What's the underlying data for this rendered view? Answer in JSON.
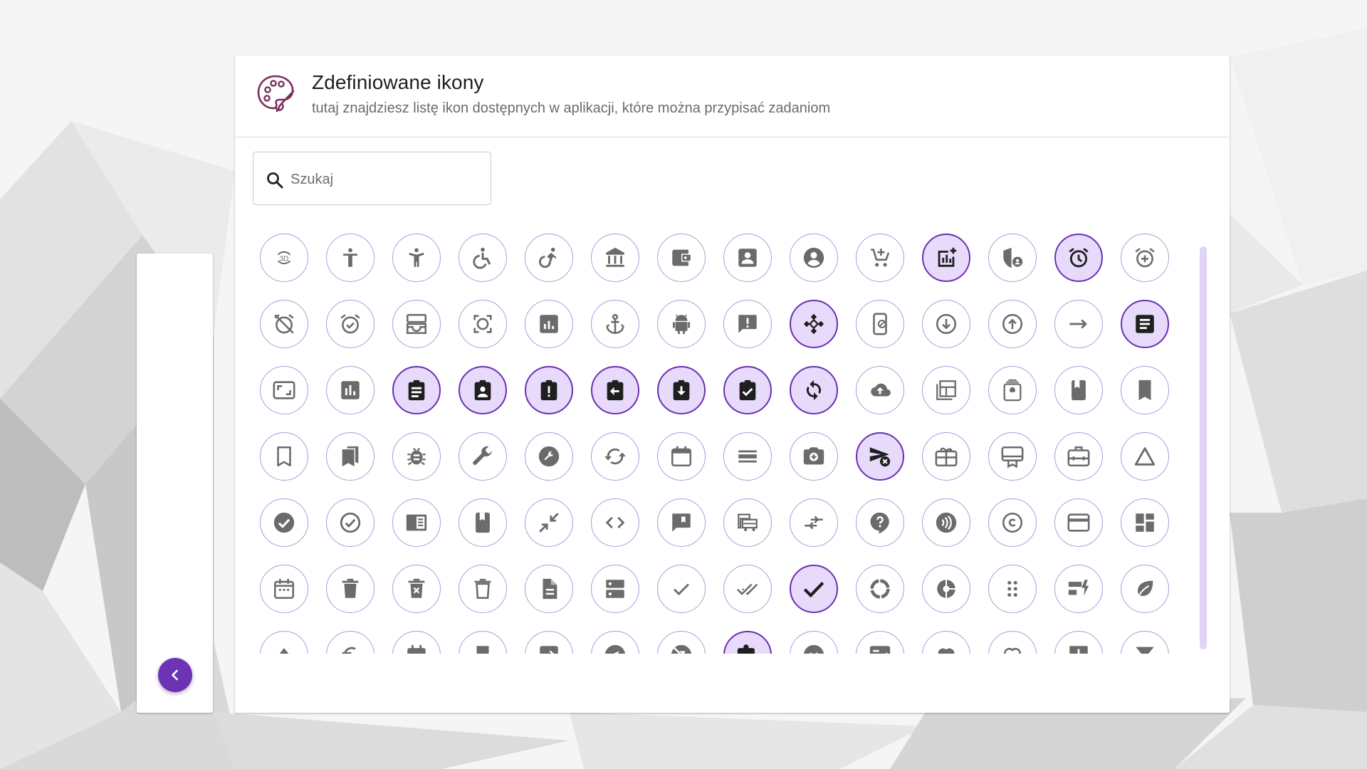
{
  "header": {
    "title": "Zdefiniowane ikony",
    "subtitle": "tutaj znajdziesz listę ikon dostępnych w aplikacji, które można przypisać zadaniom",
    "logo_icon": "palette-icon",
    "icon_color": "#7a2d5c"
  },
  "search": {
    "placeholder": "Szukaj",
    "value": "",
    "icon": "search-icon"
  },
  "sidebar": {
    "collapse_icon": "chevron-left-icon",
    "collapse_color": "#6c34b5"
  },
  "colors": {
    "icon_border": "#b497dd",
    "selected_background": "#e7dafb",
    "selected_border": "#6a2fb3",
    "icon_fill": "#6b6b6b",
    "selected_icon_fill": "#1f1f1f"
  },
  "icons": [
    {
      "name": "3d-rotation-icon",
      "text": "3D",
      "selected": false
    },
    {
      "name": "accessibility-icon",
      "selected": false
    },
    {
      "name": "accessibility-new-icon",
      "selected": false
    },
    {
      "name": "accessible-icon",
      "selected": false
    },
    {
      "name": "accessible-forward-icon",
      "selected": false
    },
    {
      "name": "account-balance-icon",
      "selected": false
    },
    {
      "name": "account-balance-wallet-icon",
      "selected": false
    },
    {
      "name": "account-box-icon",
      "selected": false
    },
    {
      "name": "account-circle-icon",
      "selected": false
    },
    {
      "name": "add-shopping-cart-icon",
      "selected": false
    },
    {
      "name": "addchart-icon",
      "selected": true
    },
    {
      "name": "admin-panel-settings-icon",
      "selected": false
    },
    {
      "name": "alarm-icon",
      "selected": true
    },
    {
      "name": "alarm-add-icon",
      "selected": false
    },
    {
      "name": "alarm-off-icon",
      "selected": false
    },
    {
      "name": "alarm-on-icon",
      "selected": false
    },
    {
      "name": "all-inbox-icon",
      "selected": false
    },
    {
      "name": "all-out-icon",
      "selected": false
    },
    {
      "name": "analytics-icon",
      "selected": false
    },
    {
      "name": "anchor-icon",
      "selected": false
    },
    {
      "name": "android-icon",
      "selected": false
    },
    {
      "name": "announcement-icon",
      "selected": false
    },
    {
      "name": "api-icon",
      "selected": true
    },
    {
      "name": "app-blocking-icon",
      "selected": false
    },
    {
      "name": "arrow-circle-down-icon",
      "selected": false
    },
    {
      "name": "arrow-circle-up-icon",
      "selected": false
    },
    {
      "name": "arrow-right-alt-icon",
      "selected": false
    },
    {
      "name": "article-icon",
      "selected": true
    },
    {
      "name": "aspect-ratio-icon",
      "selected": false
    },
    {
      "name": "assessment-icon",
      "selected": false
    },
    {
      "name": "assignment-icon",
      "selected": true
    },
    {
      "name": "assignment-ind-icon",
      "selected": true
    },
    {
      "name": "assignment-late-icon",
      "selected": true
    },
    {
      "name": "assignment-return-icon",
      "selected": true
    },
    {
      "name": "assignment-returned-icon",
      "selected": true
    },
    {
      "name": "assignment-turned-in-icon",
      "selected": true
    },
    {
      "name": "autorenew-icon",
      "selected": true
    },
    {
      "name": "backup-icon",
      "selected": false
    },
    {
      "name": "backup-table-icon",
      "selected": false
    },
    {
      "name": "batch-prediction-icon",
      "selected": false
    },
    {
      "name": "book-icon",
      "selected": false
    },
    {
      "name": "bookmark-icon",
      "selected": false
    },
    {
      "name": "bookmark-border-icon",
      "selected": false
    },
    {
      "name": "bookmarks-icon",
      "selected": false
    },
    {
      "name": "bug-report-icon",
      "selected": false
    },
    {
      "name": "build-icon",
      "selected": false
    },
    {
      "name": "build-circle-icon",
      "selected": false
    },
    {
      "name": "cached-icon",
      "selected": false
    },
    {
      "name": "calendar-today-icon",
      "selected": false
    },
    {
      "name": "calendar-view-day-icon",
      "selected": false
    },
    {
      "name": "camera-enhance-icon",
      "selected": false
    },
    {
      "name": "cancel-schedule-send-icon",
      "selected": true
    },
    {
      "name": "card-giftcard-icon",
      "selected": false
    },
    {
      "name": "card-membership-icon",
      "selected": false
    },
    {
      "name": "card-travel-icon",
      "selected": false
    },
    {
      "name": "change-history-icon",
      "selected": false
    },
    {
      "name": "check-circle-icon",
      "selected": false
    },
    {
      "name": "check-circle-outline-icon",
      "selected": false
    },
    {
      "name": "chrome-reader-mode-icon",
      "selected": false
    },
    {
      "name": "class-icon",
      "selected": false
    },
    {
      "name": "close-fullscreen-icon",
      "selected": false
    },
    {
      "name": "code-icon",
      "selected": false
    },
    {
      "name": "comment-bank-icon",
      "selected": false
    },
    {
      "name": "commute-icon",
      "selected": false
    },
    {
      "name": "compare-arrows-icon",
      "selected": false
    },
    {
      "name": "contact-support-icon",
      "selected": false
    },
    {
      "name": "contactless-icon",
      "selected": false
    },
    {
      "name": "copyright-icon",
      "selected": false
    },
    {
      "name": "credit-card-icon",
      "selected": false
    },
    {
      "name": "dashboard-icon",
      "selected": false
    },
    {
      "name": "date-range-icon",
      "selected": false
    },
    {
      "name": "delete-icon",
      "selected": false
    },
    {
      "name": "delete-forever-icon",
      "selected": false
    },
    {
      "name": "delete-outline-icon",
      "selected": false
    },
    {
      "name": "description-icon",
      "selected": false
    },
    {
      "name": "dns-icon",
      "selected": false
    },
    {
      "name": "done-icon",
      "selected": false
    },
    {
      "name": "done-all-icon",
      "selected": false
    },
    {
      "name": "done-outline-icon",
      "selected": true
    },
    {
      "name": "donut-large-icon",
      "selected": false
    },
    {
      "name": "donut-small-icon",
      "selected": false
    },
    {
      "name": "drag-indicator-icon",
      "selected": false
    },
    {
      "name": "dynamic-form-icon",
      "selected": false
    },
    {
      "name": "eco-icon",
      "selected": false
    },
    {
      "name": "eject-icon",
      "selected": false
    },
    {
      "name": "euro-symbol-icon",
      "selected": false
    },
    {
      "name": "event-icon",
      "selected": false
    },
    {
      "name": "event-seat-icon",
      "selected": false
    },
    {
      "name": "exit-to-app-icon",
      "selected": false
    },
    {
      "name": "explore-icon",
      "selected": false
    },
    {
      "name": "explore-off-icon",
      "selected": false
    },
    {
      "name": "extension-icon",
      "selected": true
    },
    {
      "name": "face-icon",
      "selected": false
    },
    {
      "name": "fact-check-icon",
      "selected": false
    },
    {
      "name": "favorite-icon",
      "selected": false
    },
    {
      "name": "favorite-border-icon",
      "selected": false
    },
    {
      "name": "feedback-icon",
      "selected": false
    },
    {
      "name": "filter-alt-icon",
      "selected": false
    }
  ]
}
